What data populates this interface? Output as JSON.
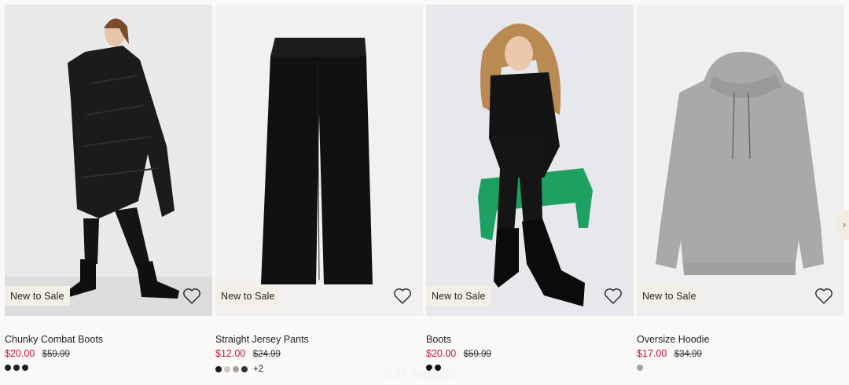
{
  "products": [
    {
      "name": "Chunky Combat Boots",
      "badge": "New to Sale",
      "price_sale": "$20.00",
      "price_original": "$59.99",
      "swatches": [
        "#222222",
        "#222222",
        "#222222"
      ],
      "more_colors": ""
    },
    {
      "name": "Straight Jersey Pants",
      "badge": "New to Sale",
      "price_sale": "$12.00",
      "price_original": "$24.99",
      "swatches": [
        "#1a1a1a",
        "#c9c9c9",
        "#a79f94",
        "#333333"
      ],
      "more_colors": "+2"
    },
    {
      "name": "Boots",
      "badge": "New to Sale",
      "price_sale": "$20.00",
      "price_original": "$59.99",
      "swatches": [
        "#111111",
        "#111111"
      ],
      "more_colors": ""
    },
    {
      "name": "Oversize Hoodie",
      "badge": "New to Sale",
      "price_sale": "$17.00",
      "price_original": "$34.99",
      "swatches": [
        "#a3a3a3"
      ],
      "more_colors": ""
    }
  ],
  "scroll_button_icon": "chevron-right-icon",
  "favorite_icon": "heart-outline-icon",
  "watermark_text": "Chi na2au",
  "colors": {
    "sale_price": "#c6143b",
    "badge_bg": "#f4efe6",
    "page_bg": "#faf9f8"
  }
}
